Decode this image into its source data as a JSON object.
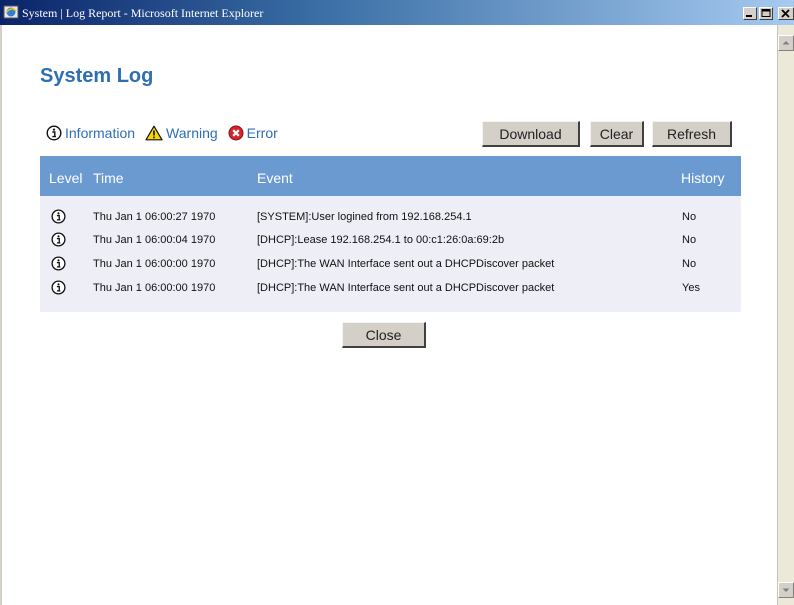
{
  "window": {
    "title": "System | Log Report - Microsoft Internet Explorer",
    "icon": "ie-icon"
  },
  "page": {
    "title": "System Log"
  },
  "legend": [
    {
      "label": "Information",
      "icon": "info-icon"
    },
    {
      "label": "Warning",
      "icon": "warning-icon"
    },
    {
      "label": "Error",
      "icon": "error-icon"
    }
  ],
  "toolbar": {
    "download_label": "Download",
    "clear_label": "Clear",
    "refresh_label": "Refresh"
  },
  "table": {
    "headers": {
      "level": "Level",
      "time": "Time",
      "event": "Event",
      "history": "History"
    },
    "rows": [
      {
        "level": "info-icon",
        "time": "Thu Jan 1 06:00:27 1970",
        "event": "[SYSTEM]:User logined from 192.168.254.1",
        "history": "No"
      },
      {
        "level": "info-icon",
        "time": "Thu Jan 1 06:00:04 1970",
        "event": "[DHCP]:Lease 192.168.254.1 to 00:c1:26:0a:69:2b",
        "history": "No"
      },
      {
        "level": "info-icon",
        "time": "Thu Jan 1 06:00:00 1970",
        "event": "[DHCP]:The WAN Interface sent out a DHCPDiscover packet",
        "history": "No"
      },
      {
        "level": "info-icon",
        "time": "Thu Jan 1 06:00:00 1970",
        "event": "[DHCP]:The WAN Interface sent out a DHCPDiscover packet",
        "history": "Yes"
      }
    ]
  },
  "footer": {
    "close_label": "Close"
  },
  "colors": {
    "title_blue": "#2e6eb5",
    "header_bg": "#6b9ad1",
    "table_bg": "#eeeef6",
    "button_bg": "#d4d0c8"
  }
}
